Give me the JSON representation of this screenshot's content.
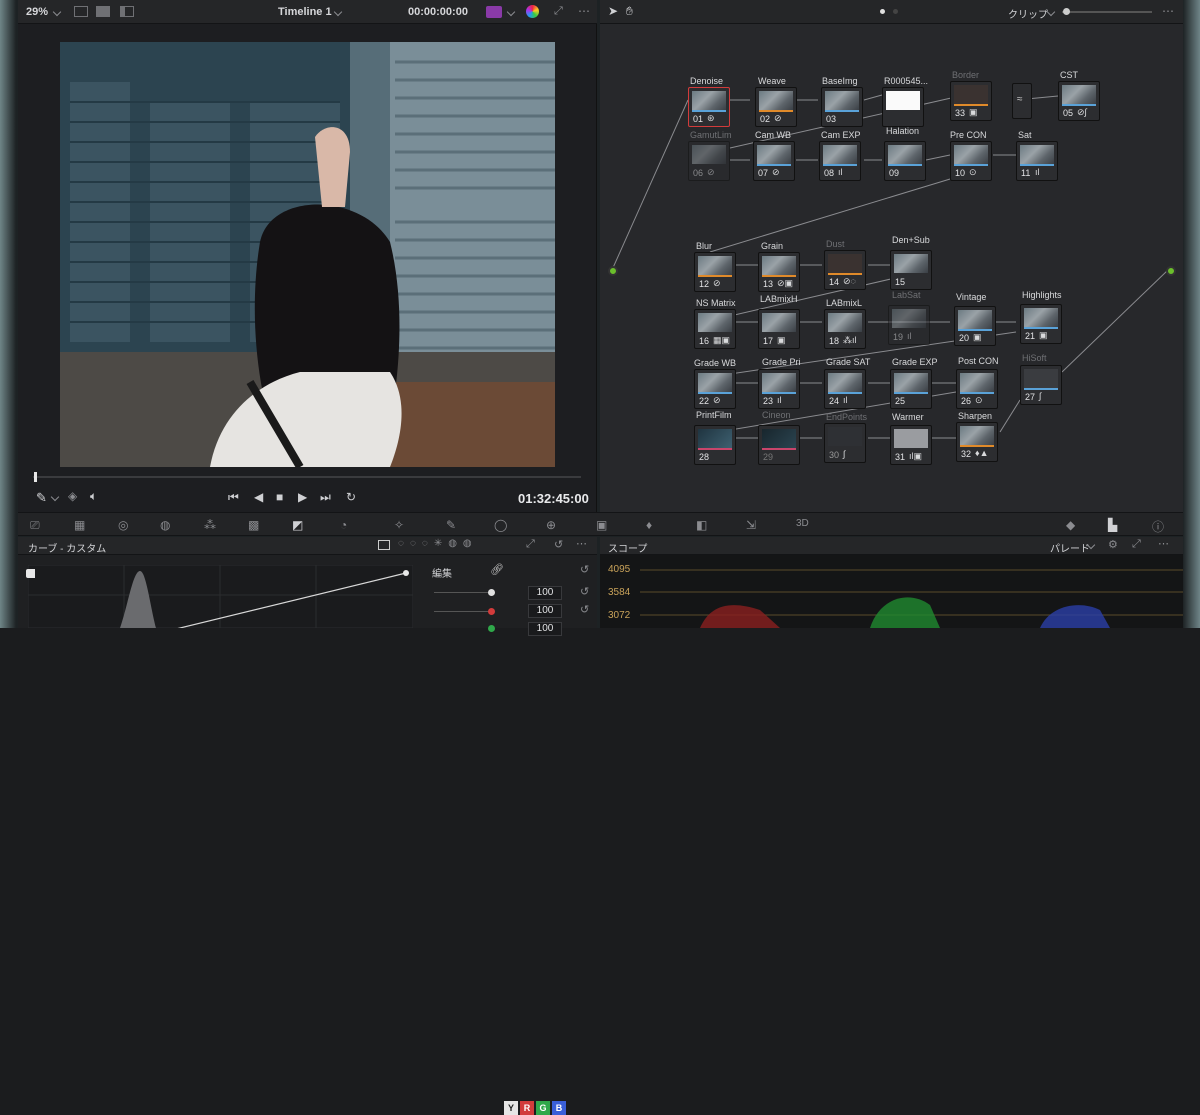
{
  "viewer": {
    "zoom": "29%",
    "timeline": "Timeline 1",
    "timecode_top": "00:00:00:00",
    "timecode_bottom": "01:32:45:00"
  },
  "node_panel": {
    "mode": "クリップ"
  },
  "nodes": [
    {
      "label": "Denoise",
      "num": "01"
    },
    {
      "label": "Weave",
      "num": "02"
    },
    {
      "label": "BaseImg",
      "num": "03"
    },
    {
      "label": "R000545...",
      "num": ""
    },
    {
      "label": "Border",
      "num": "33"
    },
    {
      "label": "CST",
      "num": "05"
    },
    {
      "label": "GamutLim",
      "num": "06"
    },
    {
      "label": "Cam WB",
      "num": "07"
    },
    {
      "label": "Cam EXP",
      "num": "08"
    },
    {
      "label": "Halation",
      "num": "09"
    },
    {
      "label": "Pre CON",
      "num": "10"
    },
    {
      "label": "Sat",
      "num": "11"
    },
    {
      "label": "Blur",
      "num": "12"
    },
    {
      "label": "Grain",
      "num": "13"
    },
    {
      "label": "Dust",
      "num": "14"
    },
    {
      "label": "Den+Sub",
      "num": "15"
    },
    {
      "label": "NS Matrix",
      "num": "16"
    },
    {
      "label": "LABmixH",
      "num": "17"
    },
    {
      "label": "LABmixL",
      "num": "18"
    },
    {
      "label": "LabSat",
      "num": "19"
    },
    {
      "label": "Vintage",
      "num": "20"
    },
    {
      "label": "Highlights",
      "num": "21"
    },
    {
      "label": "Grade WB",
      "num": "22"
    },
    {
      "label": "Grade Pri",
      "num": "23"
    },
    {
      "label": "Grade SAT",
      "num": "24"
    },
    {
      "label": "Grade EXP",
      "num": "25"
    },
    {
      "label": "Post CON",
      "num": "26"
    },
    {
      "label": "HiSoft",
      "num": "27"
    },
    {
      "label": "PrintFilm",
      "num": "28"
    },
    {
      "label": "Cineon",
      "num": "29"
    },
    {
      "label": "EndPoints",
      "num": "30"
    },
    {
      "label": "Warmer",
      "num": "31"
    },
    {
      "label": "Sharpen",
      "num": "32"
    }
  ],
  "curves": {
    "title": "カーブ - カスタム",
    "edit_label": "編集",
    "channels": [
      "Y",
      "R",
      "G",
      "B"
    ],
    "values": [
      "100",
      "100",
      "100"
    ]
  },
  "scopes": {
    "title": "スコープ",
    "mode": "パレード",
    "ticks": [
      "4095",
      "3584",
      "3072"
    ]
  },
  "colors": {
    "node_green": "#6bbf2c",
    "node_blue": "#2f8fd6",
    "selected": "#d23b3b"
  }
}
